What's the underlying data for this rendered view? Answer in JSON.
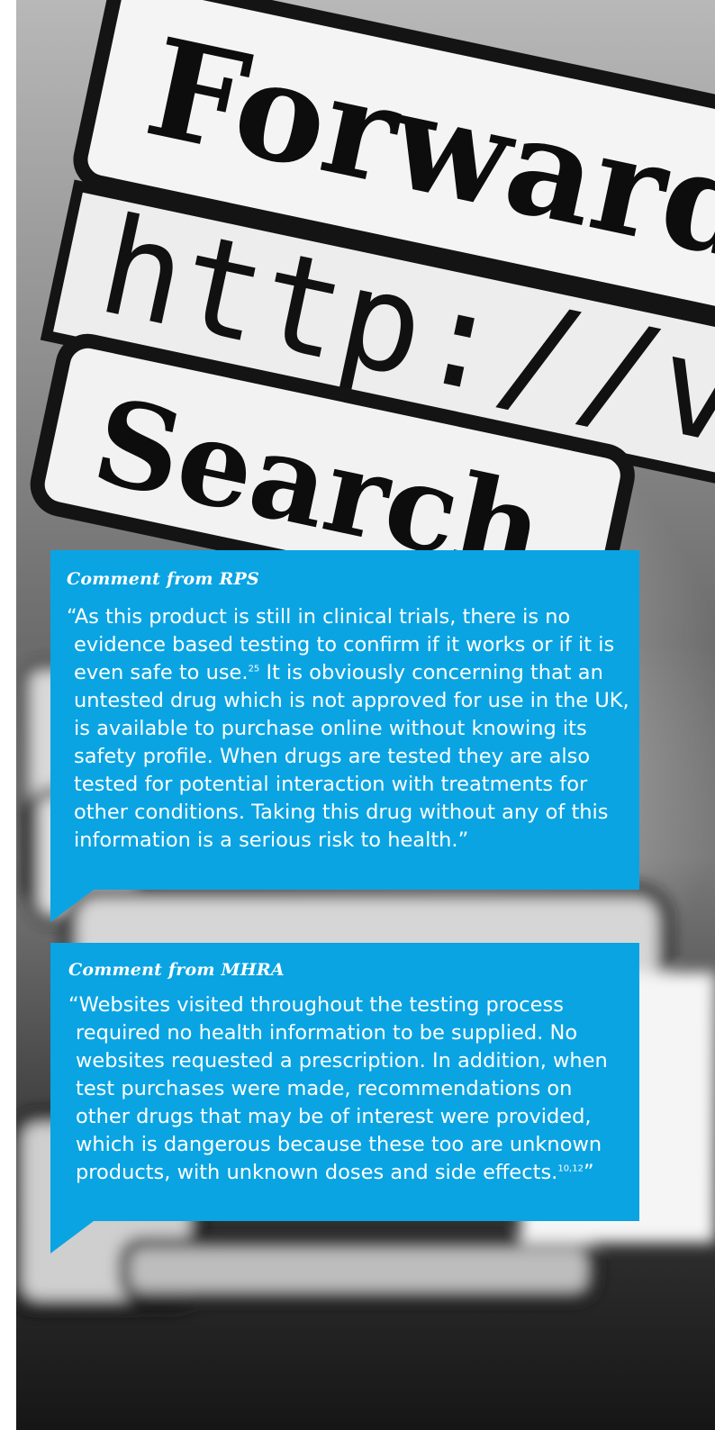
{
  "background_photo": {
    "words": [
      "Forward",
      "http://v",
      "Search"
    ]
  },
  "callouts": [
    {
      "heading": "Comment from RPS",
      "text_before_ref": "“As this product is still in clinical trials, there is no evidence based testing to confirm if it works or if it is even safe to use.",
      "ref": "25",
      "text_after_ref": " It is obviously concerning that an untested drug which is not approved for use in the UK, is available to purchase online without knowing its safety profile. When drugs are tested they are also tested for potential interaction with treatments for other conditions. Taking this drug without any of this information is a serious risk to health.”"
    },
    {
      "heading": "Comment from MHRA",
      "text_before_ref": "“Websites visited throughout the testing process required no health information to be supplied. No websites requested a prescription. In addition, when test purchases were made, recommendations on other drugs that may be of interest were provided, which is dangerous because these too are unknown products, with unknown doses and side effects.",
      "ref": "10,12",
      "text_after_ref": "”"
    }
  ],
  "colors": {
    "callout_background": "#0aa4e3",
    "callout_text": "#ffffff"
  }
}
